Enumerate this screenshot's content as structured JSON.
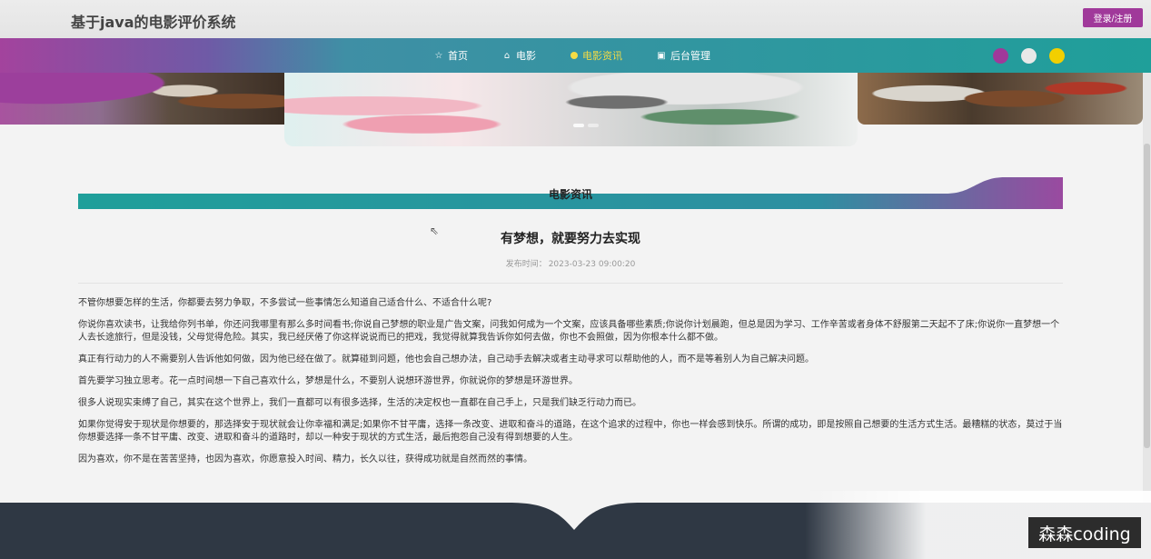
{
  "header": {
    "site_title": "基于java的电影评价系统",
    "login_label": "登录/注册"
  },
  "nav": {
    "items": [
      {
        "label": "首页",
        "icon": "star-icon",
        "glyph": "☆"
      },
      {
        "label": "电影",
        "icon": "home-icon",
        "glyph": "⌂"
      },
      {
        "label": "电影资讯",
        "icon": "dot-icon",
        "active": true
      },
      {
        "label": "后台管理",
        "icon": "doc-icon",
        "glyph": "▣"
      }
    ],
    "theme_colors": [
      "#a0399a",
      "#e8e8e8",
      "#f2cf00"
    ]
  },
  "section": {
    "title": "电影资讯"
  },
  "article": {
    "title": "有梦想，就要努力去实现",
    "publish_label": "发布时间：",
    "publish_time": "2023-03-23 09:00:20",
    "paragraphs": [
      "不管你想要怎样的生活，你都要去努力争取，不多尝试一些事情怎么知道自己适合什么、不适合什么呢?",
      "你说你喜欢读书，让我给你列书单，你还问我哪里有那么多时间看书;你说自己梦想的职业是广告文案，问我如何成为一个文案，应该具备哪些素质;你说你计划晨跑，但总是因为学习、工作辛苦或者身体不舒服第二天起不了床;你说你一直梦想一个人去长途旅行，但是没钱，父母觉得危险。其实，我已经厌倦了你这样说说而已的把戏，我觉得就算我告诉你如何去做，你也不会照做，因为你根本什么都不做。",
      "真正有行动力的人不需要别人告诉他如何做，因为他已经在做了。就算碰到问题，他也会自己想办法，自己动手去解决或者主动寻求可以帮助他的人，而不是等着别人为自己解决问题。",
      "首先要学习独立思考。花一点时间想一下自己喜欢什么，梦想是什么，不要别人说想环游世界，你就说你的梦想是环游世界。",
      "很多人说现实束缚了自己，其实在这个世界上，我们一直都可以有很多选择，生活的决定权也一直都在自己手上，只是我们缺乏行动力而已。",
      "如果你觉得安于现状是你想要的，那选择安于现状就会让你幸福和满足;如果你不甘平庸，选择一条改变、进取和奋斗的道路，在这个追求的过程中，你也一样会感到快乐。所谓的成功，即是按照自己想要的生活方式生活。最糟糕的状态，莫过于当你想要选择一条不甘平庸、改变、进取和奋斗的道路时，却以一种安于现状的方式生活，最后抱怨自己没有得到想要的人生。",
      "因为喜欢，你不是在苦苦坚持，也因为喜欢，你愿意投入时间、精力，长久以往，获得成功就是自然而然的事情。"
    ]
  },
  "watermark": "森森coding"
}
